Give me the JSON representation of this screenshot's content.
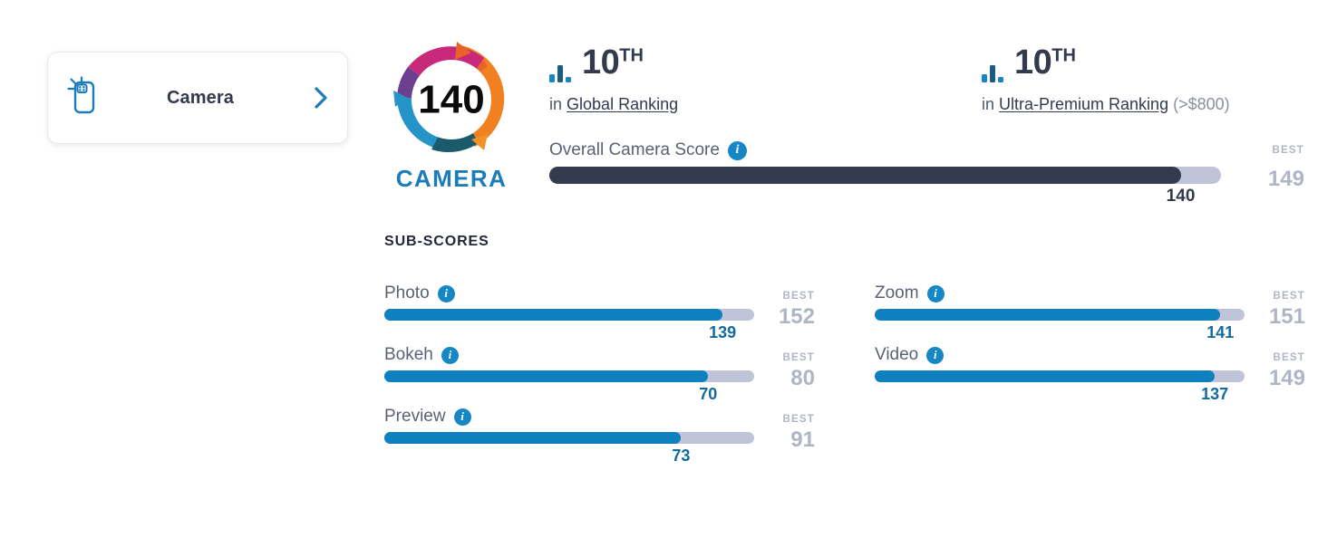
{
  "nav_card": {
    "label": "Camera",
    "icon": "phone-camera-icon",
    "chevron": "chevron-right-icon"
  },
  "score_logo": {
    "score": "140",
    "caption": "CAMERA",
    "ring_colors": {
      "magenta": "#c9297a",
      "purple": "#6d3f8f",
      "orange": "#f08020",
      "orange_dark": "#e8622a",
      "blue": "#2594c9",
      "teal_dark": "#1b5a6b"
    }
  },
  "rankings": [
    {
      "position": "10",
      "ordinal": "TH",
      "prefix": "in",
      "link": "Global Ranking",
      "note": "",
      "icon": "bar-chart-icon"
    },
    {
      "position": "10",
      "ordinal": "TH",
      "prefix": "in",
      "link": "Ultra-Premium Ranking",
      "note": " (>$800)",
      "icon": "bar-chart-icon"
    }
  ],
  "overall": {
    "title": "Overall Camera Score",
    "best_label": "BEST",
    "best_value": "149",
    "value": "140",
    "percent": 94.0
  },
  "subscores_title": "SUB-SCORES",
  "best_label": "BEST",
  "subscores": [
    {
      "name": "Photo",
      "value": "139",
      "best": "152",
      "percent": 91.4
    },
    {
      "name": "Zoom",
      "value": "141",
      "best": "151",
      "percent": 93.4
    },
    {
      "name": "Bokeh",
      "value": "70",
      "best": "80",
      "percent": 87.5
    },
    {
      "name": "Video",
      "value": "137",
      "best": "149",
      "percent": 91.9
    },
    {
      "name": "Preview",
      "value": "73",
      "best": "91",
      "percent": 80.2
    }
  ],
  "colors": {
    "accent_blue": "#0e80bf",
    "dark_navy": "#343b4e",
    "track": "#bfc4d8",
    "muted": "#b0b5c6"
  }
}
